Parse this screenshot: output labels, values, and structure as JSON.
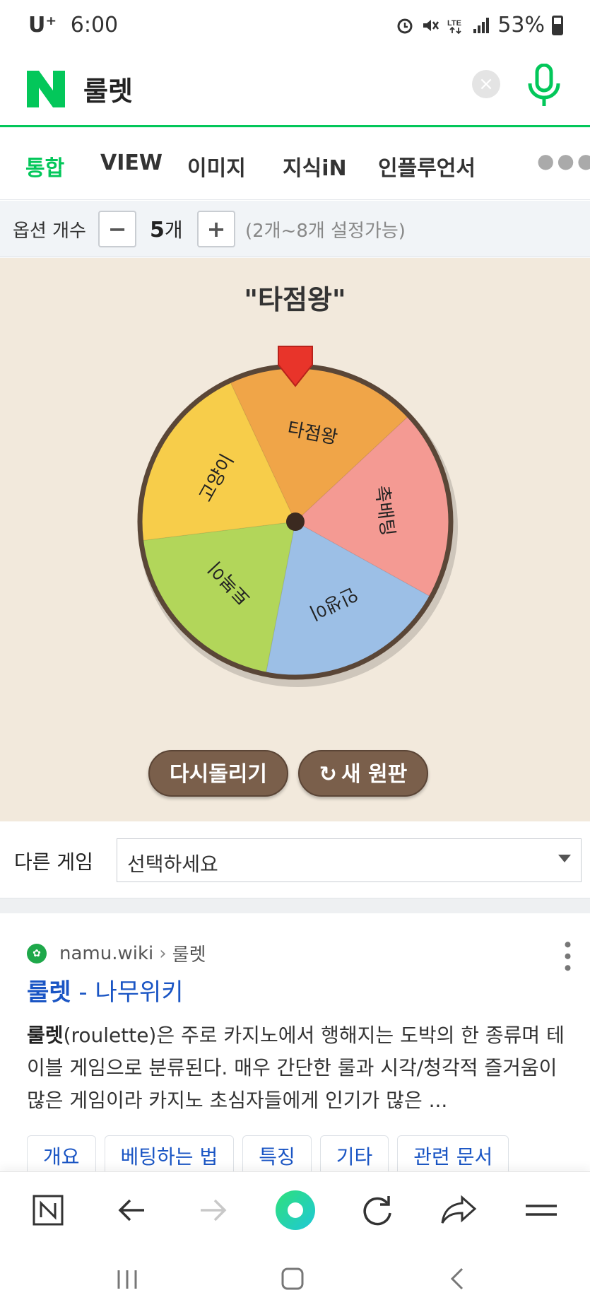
{
  "status_bar": {
    "carrier": "U⁺",
    "time": "6:00",
    "battery": "53%",
    "icons": [
      "alarm-icon",
      "mute-icon",
      "lte-icon",
      "signal-icon",
      "battery-icon"
    ]
  },
  "search": {
    "logo": "N",
    "query": "룰렛",
    "clear_icon": "×"
  },
  "tabs": [
    {
      "label": "통합",
      "active": true
    },
    {
      "label": "VIEW",
      "active": false
    },
    {
      "label": "이미지",
      "active": false
    },
    {
      "label": "지식iN",
      "active": false
    },
    {
      "label": "인플루언서",
      "active": false
    }
  ],
  "options": {
    "label": "옵션 개수",
    "minus": "−",
    "count_num": "5",
    "count_unit": "개",
    "plus": "+",
    "range": "(2개~8개 설정가능)"
  },
  "roulette": {
    "result": "\"타점왕\"",
    "segments": [
      {
        "label": "타점왕",
        "color": "#f0a548"
      },
      {
        "label": "촉배팅",
        "color": "#f49a93"
      },
      {
        "label": "인생이",
        "color": "#9cbfe6"
      },
      {
        "label": "토복이",
        "color": "#b2d65a"
      },
      {
        "label": "고양이",
        "color": "#f7cd4a"
      }
    ],
    "pointer_color": "#e8342a",
    "rim_color": "#5a4637",
    "spin_again": "다시돌리기",
    "new_wheel": "새 원판"
  },
  "other_game": {
    "label": "다른 게임",
    "select_value": "선택하세요"
  },
  "result_card": {
    "source": "namu.wiki",
    "breadcrumb": "룰렛",
    "title_main": "룰렛",
    "title_rest": " - 나무위키",
    "snippet_bold": "룰렛",
    "snippet_rest": "(roulette)은 주로 카지노에서 행해지는 도박의 한 종류며 테이블 게임으로 분류된다. 매우 간단한 룰과 시각/청각적 즐거움이 많은 게임이라 카지노 초심자들에게 인기가 많은 ...",
    "chips": [
      "개요",
      "베팅하는 법",
      "특징",
      "기타",
      "관련 문서"
    ]
  },
  "toolbar": {
    "icons": [
      "naver-home-icon",
      "back-icon",
      "forward-icon",
      "green-dot-icon",
      "refresh-icon",
      "share-icon",
      "menu-icon"
    ]
  },
  "navbar": {
    "icons": [
      "recent-apps-icon",
      "home-icon",
      "back-nav-icon"
    ]
  }
}
